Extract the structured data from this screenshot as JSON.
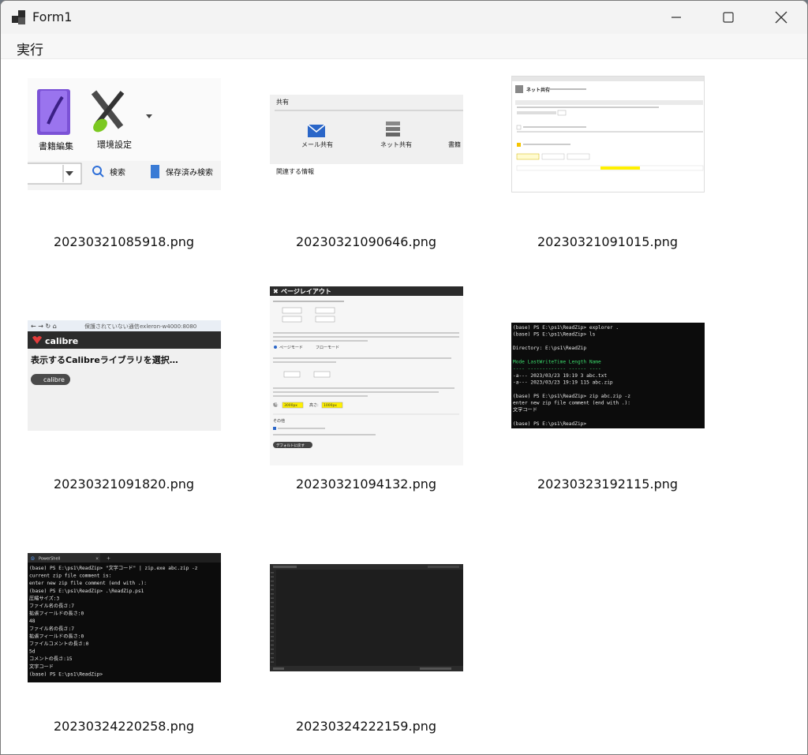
{
  "window": {
    "title": "Form1"
  },
  "menu": {
    "run_label": "実行"
  },
  "thumbnails": [
    {
      "filename": "20230321085918.png",
      "labels": {
        "book_edit": "書籍編集",
        "preferences": "環境設定",
        "search": "検索",
        "saved_search": "保存済み検索"
      }
    },
    {
      "filename": "20230321090646.png",
      "labels": {
        "section": "共有",
        "mail_share": "メール共有",
        "net_share": "ネット共有",
        "book_partial": "書籍",
        "related": "関連する情報"
      }
    },
    {
      "filename": "20230321091015.png",
      "labels": {
        "heading": "ネット共有"
      }
    },
    {
      "filename": "20230321091820.png",
      "labels": {
        "insecure": "保護されていない通信",
        "url": "exleron-w4000:8080",
        "brand": "calibre",
        "heading": "表示するCalibreライブラリを選択…",
        "library": "calibre"
      }
    },
    {
      "filename": "20230321094132.png",
      "labels": {
        "heading": "ページレイアウト",
        "page_mode": "ページモード",
        "flow_mode": "フローモード",
        "width": "幅:",
        "height": "高さ:",
        "other": "その他",
        "defaults": "デフォルトに戻す",
        "width_val": "3000px",
        "height_val": "1000px"
      }
    },
    {
      "filename": "20230323192115.png",
      "terminal": [
        "(base) PS E:\\ps1\\ReadZip> explorer .",
        "(base) PS E:\\ps1\\ReadZip> ls",
        "",
        "    Directory: E:\\ps1\\ReadZip",
        "",
        "Mode                 LastWriteTime         Length Name",
        "----                 -------------         ------ ----",
        "-a---          2023/03/23     19:19              3 abc.txt",
        "-a---          2023/03/23     19:19            115 abc.zip",
        "",
        "(base) PS E:\\ps1\\ReadZip> zip abc.zip -z",
        "enter new zip file comment (end with .):",
        "文字コード",
        "",
        "(base) PS E:\\ps1\\ReadZip>"
      ]
    },
    {
      "filename": "20230324220258.png",
      "tab": "PowerShell",
      "terminal": [
        "(base) PS E:\\ps1\\ReadZip> \"文字コード\" | zip.exe abc.zip -z",
        "current zip file comment is:",
        "enter new zip file comment (end with .):",
        "(base) PS E:\\ps1\\ReadZip> .\\ReadZip.ps1",
        "圧縮サイズ:3",
        "ファイル名の長さ:7",
        "拡張フィールドの長さ:0",
        "48",
        "ファイル名の長さ:7",
        "拡張フィールドの長さ:0",
        "ファイルコメントの長さ:0",
        "5d",
        "コメントの長さ:15",
        "文字コード",
        "(base) PS E:\\ps1\\ReadZip>"
      ]
    },
    {
      "filename": "20230324222159.png"
    }
  ]
}
